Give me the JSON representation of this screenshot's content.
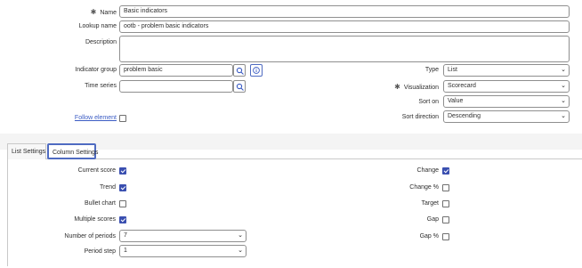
{
  "form": {
    "name_label": "Name",
    "name_value": "Basic indicators",
    "lookup_label": "Lookup name",
    "lookup_value": "ootb - problem basic indicators",
    "description_label": "Description",
    "description_value": "",
    "indicator_group_label": "Indicator group",
    "indicator_group_value": "problem basic",
    "time_series_label": "Time series",
    "time_series_value": "",
    "follow_element_label": "Follow element",
    "type_label": "Type",
    "type_value": "List",
    "visualization_label": "Visualization",
    "visualization_value": "Scorecard",
    "sort_on_label": "Sort on",
    "sort_on_value": "Value",
    "sort_direction_label": "Sort direction",
    "sort_direction_value": "Descending",
    "required_mark": "✱"
  },
  "tabs": {
    "list_settings": "List Settings",
    "column_settings": "Column Settings"
  },
  "columns": {
    "current_score": {
      "label": "Current score",
      "checked": true
    },
    "trend": {
      "label": "Trend",
      "checked": true
    },
    "bullet_chart": {
      "label": "Bullet chart",
      "checked": false
    },
    "multiple_scores": {
      "label": "Multiple scores",
      "checked": true
    },
    "number_of_periods_label": "Number of periods",
    "number_of_periods_value": "7",
    "period_step_label": "Period step",
    "period_step_value": "1",
    "change": {
      "label": "Change",
      "checked": true
    },
    "change_pct": {
      "label": "Change %",
      "checked": false
    },
    "target": {
      "label": "Target",
      "checked": false
    },
    "gap": {
      "label": "Gap",
      "checked": false
    },
    "gap_pct": {
      "label": "Gap %",
      "checked": false
    }
  },
  "icons": {
    "search": "search-icon",
    "info": "info-icon",
    "chevron": "chevron-down-icon"
  },
  "colors": {
    "accent": "#3a4fb0",
    "link": "#3b5cc4",
    "tab_border": "#4f6bc1"
  }
}
